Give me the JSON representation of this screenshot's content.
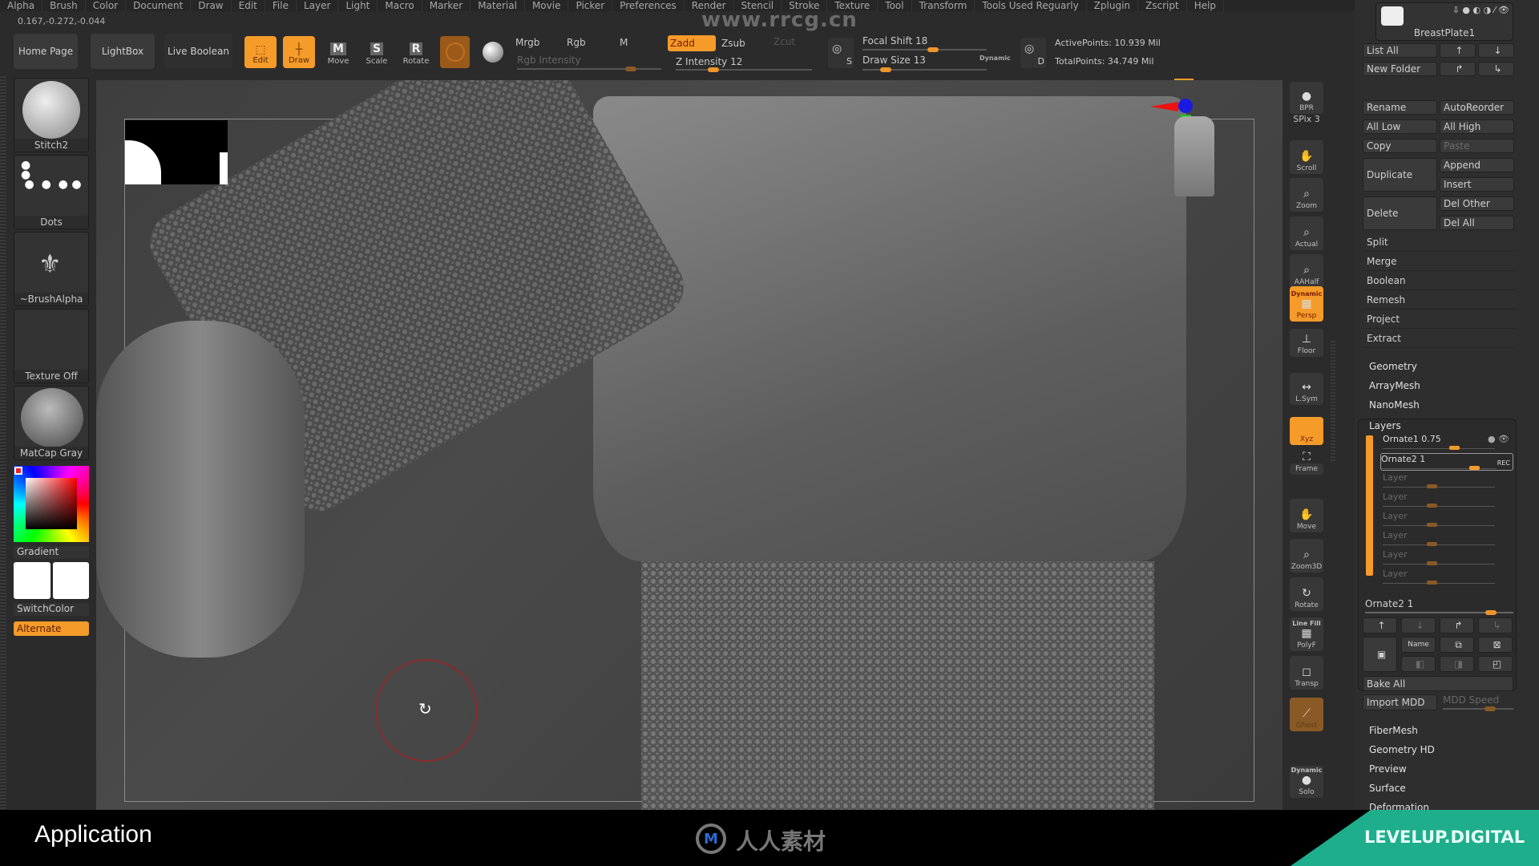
{
  "menu": [
    "Alpha",
    "Brush",
    "Color",
    "Document",
    "Draw",
    "Edit",
    "File",
    "Layer",
    "Light",
    "Macro",
    "Marker",
    "Material",
    "Movie",
    "Picker",
    "Preferences",
    "Render",
    "Stencil",
    "Stroke",
    "Texture",
    "Tool",
    "Transform",
    "Tools Used Reguarly",
    "Zplugin",
    "Zscript",
    "Help"
  ],
  "coords": "0.167,-0.272,-0.044",
  "watermark_url": "www.rrcg.cn",
  "toolbar": {
    "home_page": "Home Page",
    "lightbox": "LightBox",
    "live_boolean": "Live Boolean",
    "edit": "Edit",
    "draw": "Draw",
    "move": "Move",
    "scale": "Scale",
    "rotate": "Rotate",
    "move_glyph": "M",
    "scale_glyph": "S",
    "rotate_glyph": "R",
    "mrgb": "Mrgb",
    "rgb": "Rgb",
    "m": "M",
    "rgb_intensity": "Rgb Intensity",
    "zadd": "Zadd",
    "zsub": "Zsub",
    "zcut": "Zcut",
    "z_intensity": "Z Intensity 12",
    "z_intensity_value": 12,
    "focal_shift": "Focal Shift 18",
    "focal_shift_value": 18,
    "draw_size": "Draw Size 13",
    "draw_size_value": 13,
    "dynamic": "Dynamic",
    "s_label": "S",
    "d_label": "D",
    "active_points": "ActivePoints: 10.939 Mil",
    "total_points": "TotalPoints: 34.749 Mil"
  },
  "left_shelf": {
    "brush": "Stitch2",
    "stroke": "Dots",
    "alpha": "~BrushAlpha",
    "texture": "Texture Off",
    "material": "MatCap Gray",
    "gradient": "Gradient",
    "switch_color": "SwitchColor",
    "alternate": "Alternate"
  },
  "right_shelf": [
    {
      "name": "bpr",
      "label": "BPR"
    },
    {
      "name": "spix",
      "label": "SPix 3"
    },
    {
      "name": "scroll",
      "label": "Scroll"
    },
    {
      "name": "zoom",
      "label": "Zoom"
    },
    {
      "name": "actual",
      "label": "Actual"
    },
    {
      "name": "aahalf",
      "label": "AAHalf"
    },
    {
      "name": "persp",
      "label": "Persp",
      "top": "Dynamic"
    },
    {
      "name": "floor",
      "label": "Floor"
    },
    {
      "name": "lsym",
      "label": "L.Sym"
    },
    {
      "name": "xyz",
      "label": "Xyz"
    },
    {
      "name": "frame",
      "label": "Frame"
    },
    {
      "name": "move",
      "label": "Move"
    },
    {
      "name": "zoom3d",
      "label": "Zoom3D"
    },
    {
      "name": "rotate",
      "label": "Rotate"
    },
    {
      "name": "polyf",
      "label": "PolyF",
      "top": "Line Fill"
    },
    {
      "name": "transp",
      "label": "Transp"
    },
    {
      "name": "ghost",
      "label": "Ghost"
    },
    {
      "name": "solo",
      "label": "Solo",
      "top": "Dynamic"
    }
  ],
  "subtool": {
    "current": "BreastPlate1",
    "list_all": "List All",
    "new_folder": "New Folder",
    "rename": "Rename",
    "auto_reorder": "AutoReorder",
    "all_low": "All Low",
    "all_high": "All High",
    "copy": "Copy",
    "paste": "Paste",
    "duplicate": "Duplicate",
    "append": "Append",
    "insert": "Insert",
    "delete": "Delete",
    "del_other": "Del Other",
    "del_all": "Del All",
    "rows": [
      "Split",
      "Merge",
      "Boolean",
      "Remesh",
      "Project",
      "Extract"
    ]
  },
  "sections_top": [
    "Geometry",
    "ArrayMesh",
    "NanoMesh"
  ],
  "layers": {
    "title": "Layers",
    "items": [
      {
        "name": "Ornate1 0.75",
        "value": 0.75
      },
      {
        "name": "Ornate2 1",
        "value": 1,
        "rec": "REC"
      },
      {
        "name": "Layer"
      },
      {
        "name": "Layer"
      },
      {
        "name": "Layer"
      },
      {
        "name": "Layer"
      },
      {
        "name": "Layer"
      },
      {
        "name": "Layer"
      }
    ],
    "selected_label": "Ornate2 1",
    "name_btn": "Name",
    "bake_all": "Bake All",
    "import_mdd": "Import MDD",
    "mdd_speed": "MDD Speed"
  },
  "sections_bottom": [
    "FiberMesh",
    "Geometry HD",
    "Preview",
    "Surface",
    "Deformation"
  ],
  "bottom": {
    "title": "Application",
    "center_logo": "人人素材",
    "brand": "LEVELUP.DIGITAL"
  },
  "colors": {
    "accent": "#f49b2a",
    "brand": "#1fae8c"
  }
}
